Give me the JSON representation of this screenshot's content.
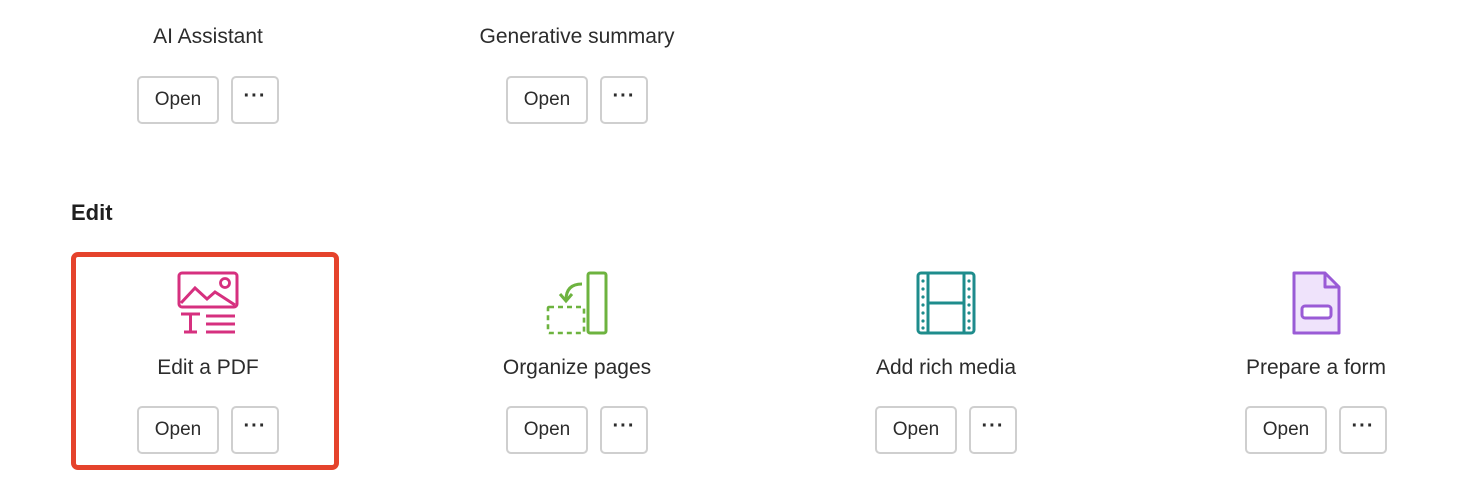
{
  "top_tools": [
    {
      "label": "AI Assistant",
      "open_label": "Open",
      "more_label": "···"
    },
    {
      "label": "Generative summary",
      "open_label": "Open",
      "more_label": "···"
    }
  ],
  "edit_section": {
    "title": "Edit",
    "tools": [
      {
        "label": "Edit a PDF",
        "open_label": "Open",
        "more_label": "···",
        "icon": "edit-pdf-icon",
        "color": "#d6307f"
      },
      {
        "label": "Organize pages",
        "open_label": "Open",
        "more_label": "···",
        "icon": "organize-pages-icon",
        "color": "#6db33f"
      },
      {
        "label": "Add rich media",
        "open_label": "Open",
        "more_label": "···",
        "icon": "rich-media-icon",
        "color": "#1e8c8c"
      },
      {
        "label": "Prepare a form",
        "open_label": "Open",
        "more_label": "···",
        "icon": "prepare-form-icon",
        "color": "#9a5bd6"
      }
    ]
  },
  "highlight_color": "#e5432c"
}
